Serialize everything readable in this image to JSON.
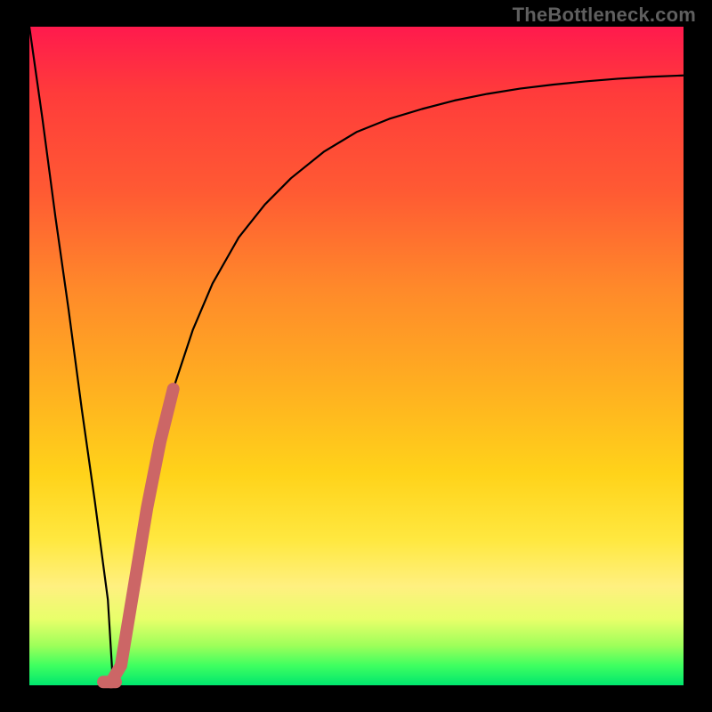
{
  "watermark": "TheBottleneck.com",
  "chart_data": {
    "type": "line",
    "title": "",
    "xlabel": "",
    "ylabel": "",
    "xlim": [
      0,
      100
    ],
    "ylim": [
      0,
      100
    ],
    "grid": false,
    "legend": false,
    "series": [
      {
        "name": "bottleneck-curve",
        "color": "#000000",
        "x": [
          0,
          2,
          4,
          6,
          8,
          10,
          12,
          12.8,
          14,
          16,
          18,
          20,
          22,
          25,
          28,
          32,
          36,
          40,
          45,
          50,
          55,
          60,
          65,
          70,
          75,
          80,
          85,
          90,
          95,
          100
        ],
        "y": [
          100,
          86,
          71,
          57,
          42,
          28,
          13,
          0,
          3,
          15,
          27,
          37,
          45,
          54,
          61,
          68,
          73,
          77,
          81,
          84,
          86,
          87.5,
          88.8,
          89.8,
          90.6,
          91.2,
          91.7,
          92.1,
          92.4,
          92.6
        ]
      },
      {
        "name": "highlight-segment",
        "color": "#cc6666",
        "x": [
          12.5,
          14,
          16,
          18,
          20,
          22
        ],
        "y": [
          0.5,
          3,
          15,
          27,
          37,
          45
        ]
      },
      {
        "name": "highlight-base",
        "color": "#cc6666",
        "x": [
          11.3,
          13.2
        ],
        "y": [
          0.5,
          0.5
        ]
      }
    ]
  }
}
